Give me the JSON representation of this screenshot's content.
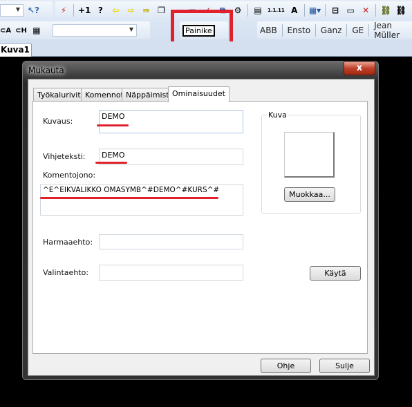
{
  "toolbar": {
    "row1_icons": [
      "pointer-help-icon",
      "lightning-icon",
      "plus-one-icon",
      "question-icon",
      "arrow-left-icon",
      "arrow-right-icon",
      "arrow-skip-icon",
      "windows-icon",
      "frame-icon",
      "check-icon",
      "copy-icon",
      "gear-icon",
      "label-icon",
      "numbering-icon",
      "text-a-icon",
      "table-icon",
      "insert-icon",
      "tag-icon",
      "delete-icon",
      "folder-link-icon",
      "link-icon"
    ],
    "row1_labels": {
      "plus_one": "+1",
      "question": "?",
      "numbering": "1.1.11",
      "text_a": "A"
    },
    "painike": "Painike",
    "vendors": [
      "ABB",
      "Ensto",
      "Ganz",
      "GE",
      "Jean Müller"
    ]
  },
  "document_tab": "Kuva1",
  "dialog": {
    "title": "Mukauta",
    "close": "x",
    "tabs": [
      "Työkalurivit",
      "Komennot",
      "Näppäimistö",
      "Ominaisuudet"
    ],
    "active_tab": "Ominaisuudet",
    "fields": {
      "kuvaus_label": "Kuvaus:",
      "kuvaus_value": "DEMO",
      "vihjeteksti_label": "Vihjeteksti:",
      "vihjeteksti_value": "DEMO",
      "komentojono_label": "Komentojono:",
      "komentojono_value": "^E^EIKVALIKKO OMASYMB^#DEMO^#KURS^#",
      "harmaaehto_label": "Harmaaehto:",
      "harmaaehto_value": "",
      "valintaehto_label": "Valintaehto:",
      "valintaehto_value": ""
    },
    "kuva_group": "Kuva",
    "edit_button": "Muokkaa...",
    "apply_button": "Käytä",
    "help_button": "Ohje",
    "close_button": "Sulje"
  },
  "colors": {
    "highlight": "#e0202a",
    "toolbar": "#dbe5f3"
  }
}
